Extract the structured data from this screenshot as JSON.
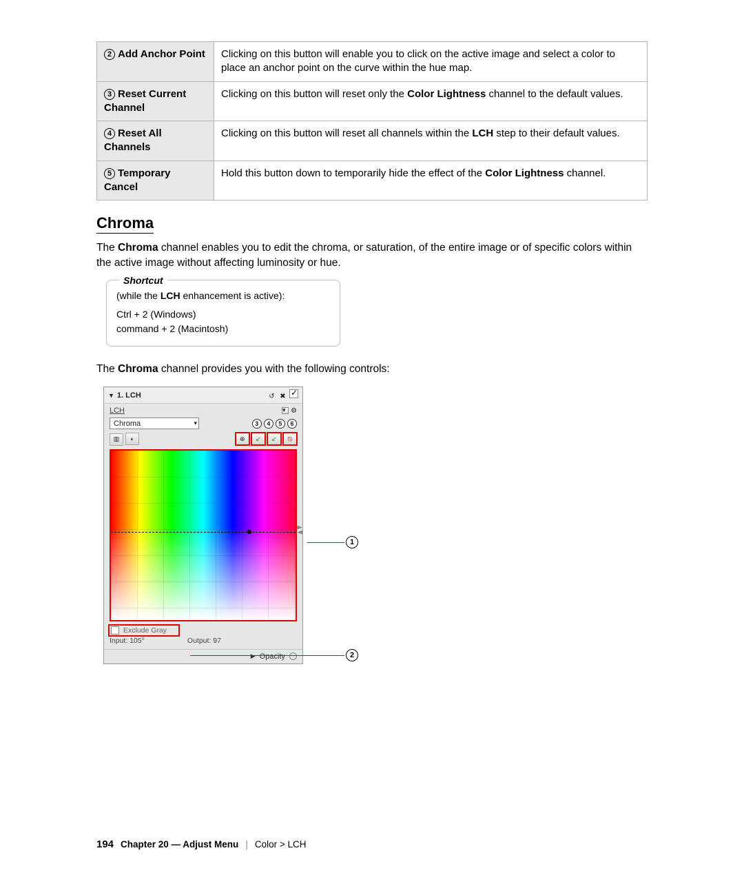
{
  "table": [
    {
      "num": "2",
      "term": "Add Anchor Point",
      "desc": "Clicking on this button will enable you to click on the active image and select a color to place an anchor point on the curve within the hue map."
    },
    {
      "num": "3",
      "term": "Reset Current Channel",
      "desc_pre": "Clicking on this button will reset only the ",
      "desc_bold": "Color Lightness",
      "desc_post": " channel to the default values."
    },
    {
      "num": "4",
      "term": "Reset All Channels",
      "desc_pre": "Clicking on this button will reset all channels within the ",
      "desc_bold": "LCH",
      "desc_post": " step to their default values."
    },
    {
      "num": "5",
      "term": "Temporary Cancel",
      "desc_pre": "Hold this button down to temporarily hide the effect of the ",
      "desc_bold": "Color Lightness",
      "desc_post": " channel."
    }
  ],
  "section_title": "Chroma",
  "intro": {
    "pre": "The ",
    "bold": "Chroma",
    "post": " channel enables you to edit the chroma, or saturation, of the entire image or of specific colors within the active image without affecting luminosity or hue."
  },
  "shortcut": {
    "legend": "Shortcut",
    "line1_pre": "(while the ",
    "line1_bold": "LCH",
    "line1_post": " enhancement is active):",
    "win": "Ctrl + 2 (Windows)",
    "mac": "command + 2 (Macintosh)"
  },
  "controls_intro": {
    "pre": "The ",
    "bold": "Chroma",
    "post": " channel provides you with the following controls:"
  },
  "panel": {
    "title": "1. LCH",
    "sub_label": "LCH",
    "channel": "Chroma",
    "callouts_top": [
      "3",
      "4",
      "5",
      "6"
    ],
    "exclude_label": "Exclude Gray",
    "input_label": "Input:",
    "input_value": "105°",
    "output_label": "Output:",
    "output_value": "97",
    "opacity": "Opacity",
    "callout1": "1",
    "callout2": "2"
  },
  "footer": {
    "page": "194",
    "chapter": "Chapter 20 — Adjust Menu",
    "breadcrumb": "Color > LCH"
  }
}
